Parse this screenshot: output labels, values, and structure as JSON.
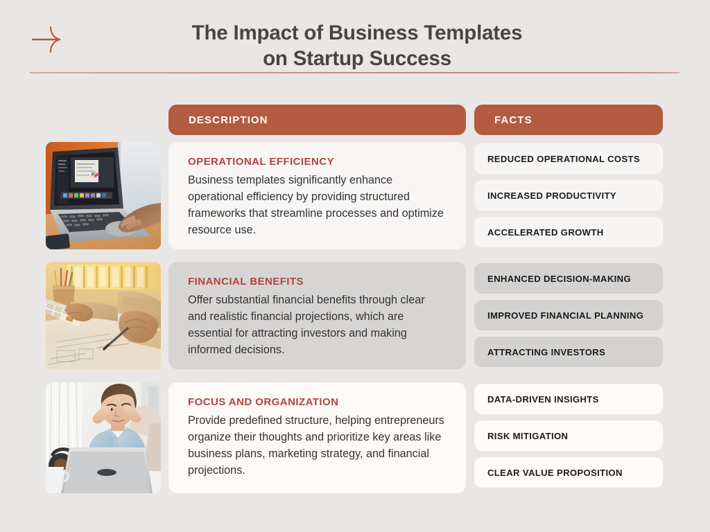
{
  "header": {
    "title": "The Impact of Business Templates\non Startup Success",
    "arrow_icon": "arrow-right-icon"
  },
  "columns": {
    "description_label": "DESCRIPTION",
    "facts_label": "FACTS"
  },
  "colors": {
    "page_background": "#e8e7e5",
    "header_bar": "#b35b41",
    "section_heading": "#b1453f",
    "title_text": "#4a4440",
    "rule": "#c8705a"
  },
  "rows": [
    {
      "image": {
        "name": "laptop-typing-photo",
        "alt": "Hands typing on a silver laptop at a wooden desk with an orange wall"
      },
      "description": {
        "title": "OPERATIONAL EFFICIENCY",
        "body": "Business templates significantly enhance operational efficiency by providing structured frameworks that streamline processes and optimize resource use."
      },
      "facts": [
        "REDUCED OPERATIONAL COSTS",
        "INCREASED PRODUCTIVITY",
        "ACCELERATED GROWTH"
      ]
    },
    {
      "image": {
        "name": "calculator-blueprint-photo",
        "alt": "Hands using a calculator and pen over blueprints in warm golden light"
      },
      "description": {
        "title": "FINANCIAL BENEFITS",
        "body": "Offer substantial financial benefits through clear and realistic financial projections, which are essential for attracting investors and making informed decisions."
      },
      "facts": [
        "ENHANCED DECISION-MAKING",
        "IMPROVED FINANCIAL PLANNING",
        "ATTRACTING INVESTORS"
      ]
    },
    {
      "image": {
        "name": "focused-man-laptop-photo",
        "alt": "Man in a light blue shirt concentrating in front of a laptop"
      },
      "description": {
        "title": "FOCUS AND ORGANIZATION",
        "body": "Provide predefined structure, helping entrepreneurs organize their thoughts and prioritize key areas like business plans, marketing strategy, and financial projections."
      },
      "facts": [
        "DATA-DRIVEN INSIGHTS",
        "RISK MITIGATION",
        "CLEAR VALUE PROPOSITION"
      ]
    }
  ]
}
